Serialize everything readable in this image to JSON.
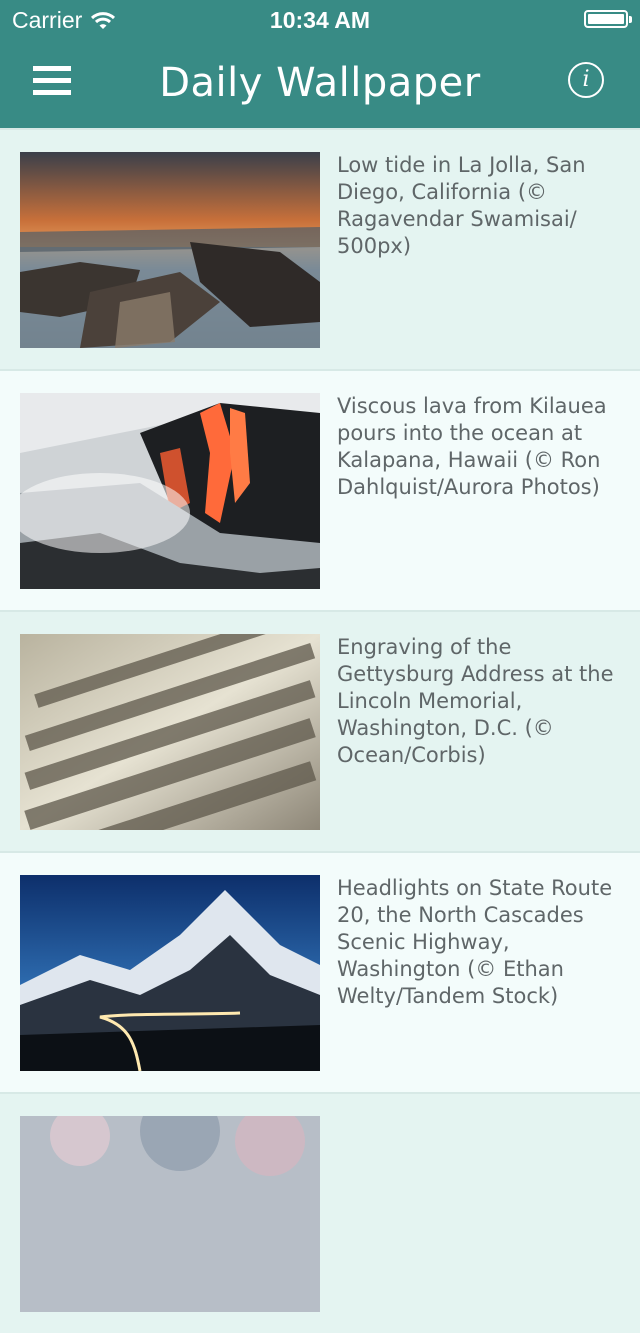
{
  "status_bar": {
    "carrier": "Carrier",
    "time": "10:34 AM"
  },
  "nav": {
    "title": "Daily Wallpaper",
    "menu_icon": "hamburger-icon",
    "info_icon": "info-icon",
    "info_glyph": "i"
  },
  "colors": {
    "header": "#388b85",
    "row_odd": "#e4f4f1",
    "row_even": "#f3fcfb",
    "caption_text": "#5f6668"
  },
  "wallpapers": [
    {
      "caption": "Low tide in La Jolla, San Diego, California (© Ragavendar Swamisai/ 500px)"
    },
    {
      "caption": "Viscous lava from Kilauea pours into the ocean at Kalapana, Hawaii (© Ron Dahlquist/Aurora Photos)"
    },
    {
      "caption": "Engraving of the Gettysburg Address at the Lincoln Memorial, Washington, D.C. (© Ocean/Corbis)"
    },
    {
      "caption": "Headlights on State Route 20, the North Cascades Scenic Highway, Washington (© Ethan Welty/Tandem Stock)"
    },
    {
      "caption": ""
    }
  ]
}
